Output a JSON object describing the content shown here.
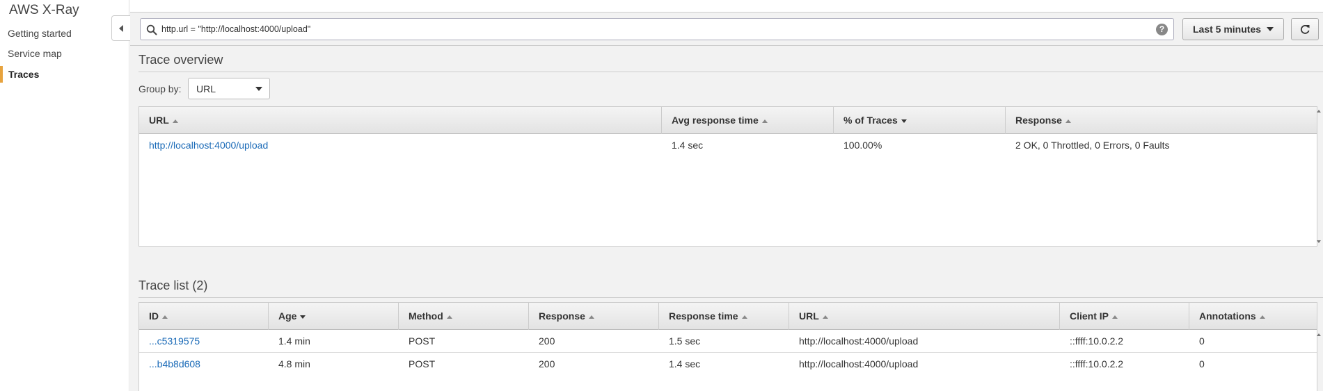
{
  "app": {
    "title": "AWS X-Ray"
  },
  "sidebar": {
    "items": [
      {
        "label": "Getting started",
        "active": false
      },
      {
        "label": "Service map",
        "active": false
      },
      {
        "label": "Traces",
        "active": true
      }
    ]
  },
  "toolbar": {
    "filter_value": "http.url = \"http://localhost:4000/upload\"",
    "help_label": "?",
    "time_range": "Last 5 minutes",
    "icons": {
      "search": "search-icon",
      "help": "help-icon",
      "refresh": "refresh-icon",
      "time": "chevron-down-icon"
    }
  },
  "overview": {
    "title": "Trace overview",
    "group_by_label": "Group by:",
    "group_by_value": "URL",
    "columns": [
      "URL",
      "Avg response time",
      "% of Traces",
      "Response"
    ],
    "rows": [
      {
        "url": "http://localhost:4000/upload",
        "avg": "1.4 sec",
        "pct": "100.00%",
        "response": "2 OK, 0 Throttled, 0 Errors, 0 Faults"
      }
    ]
  },
  "trace_list": {
    "title": "Trace list (2)",
    "columns": [
      "ID",
      "Age",
      "Method",
      "Response",
      "Response time",
      "URL",
      "Client IP",
      "Annotations"
    ],
    "rows": [
      {
        "id": "...c5319575",
        "age": "1.4 min",
        "method": "POST",
        "response": "200",
        "response_time": "1.5 sec",
        "url": "http://localhost:4000/upload",
        "client_ip": "::ffff:10.0.2.2",
        "annotations": "0"
      },
      {
        "id": "...b4b8d608",
        "age": "4.8 min",
        "method": "POST",
        "response": "200",
        "response_time": "1.4 sec",
        "url": "http://localhost:4000/upload",
        "client_ip": "::ffff:10.0.2.2",
        "annotations": "0"
      }
    ]
  },
  "colors": {
    "accent": "#e7a33e",
    "link": "#1a6ab7",
    "background": "#f2f2f2"
  }
}
